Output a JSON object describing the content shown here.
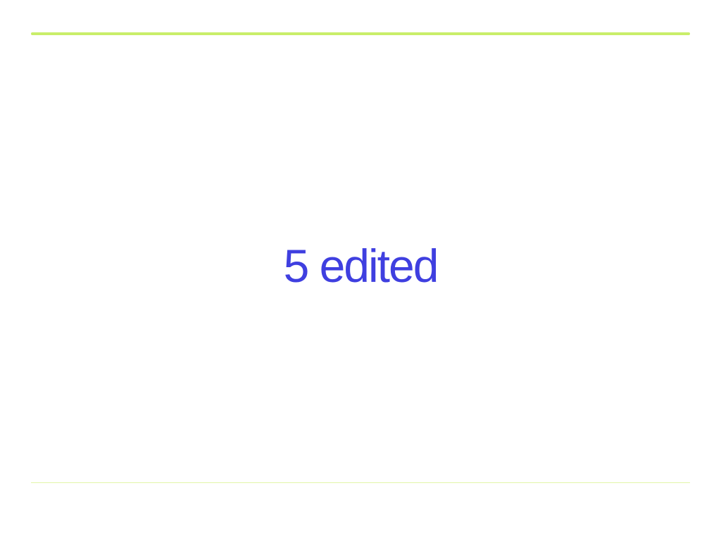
{
  "headline": {
    "text": "5 edited",
    "color": "#3f3fe0"
  },
  "rules": {
    "accent_color": "#c9ee6a",
    "light_color": "#e2f5a8"
  }
}
